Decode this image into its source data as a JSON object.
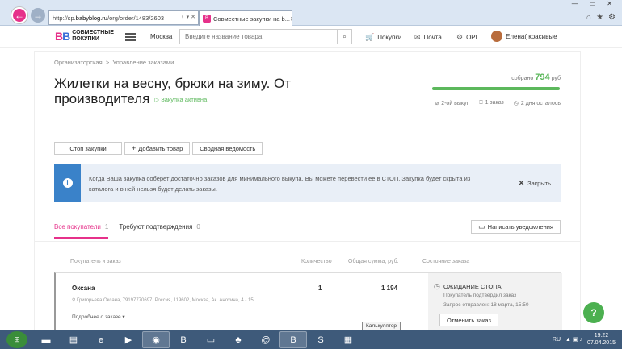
{
  "browser": {
    "url_prefix": "http://sp.",
    "url_host": "babyblog.ru",
    "url_path": "/org/order/1483/2603",
    "address_tools": "♀ ▾ ✕",
    "tab_title": "Совместные закупки на b...",
    "tab_close": "✕",
    "window_controls": [
      "—",
      "▭",
      "✕"
    ],
    "toolbar_icons": [
      "⌂",
      "★",
      "⚙"
    ],
    "back_icon": "←",
    "forward_icon": "→"
  },
  "site": {
    "logo_mark_a": "B",
    "logo_mark_b": "B",
    "logo_line1": "СОВМЕСТНЫЕ",
    "logo_line2": "ПОКУПКИ",
    "city": "Москва",
    "search_placeholder": "Введите название товара",
    "search_icon": "⌕",
    "nav": [
      {
        "icon": "🛒",
        "label": "Покупки"
      },
      {
        "icon": "✉",
        "label": "Почта"
      },
      {
        "icon": "⚙",
        "label": "ОРГ"
      }
    ],
    "user_name": "Елена( красивые"
  },
  "page": {
    "breadcrumbs": [
      "Организаторская",
      "Управление заказами"
    ],
    "crumb_sep": ">",
    "title": "Жилетки на весну, брюки на зиму. От производителя",
    "status": "▷ Закупка активна",
    "collected_prefix": "собрано",
    "collected_value": "794",
    "collected_suffix": "руб",
    "progress": 1.0,
    "meta": [
      {
        "icon": "⌀",
        "text": "2-ой выкуп"
      },
      {
        "icon": "⎕",
        "text": "1 заказ"
      },
      {
        "icon": "◷",
        "text": "2 дня осталось"
      }
    ],
    "buttons": {
      "stop": "Стоп закупки",
      "add_product": "Добавить товар",
      "add_icon": "+",
      "summary": "Сводная ведомость"
    },
    "alert": {
      "icon": "i",
      "text": "Когда Ваша закупка соберет достаточно заказов для минимального выкупа, Вы можете перевести ее в СТОП. Закупка будет скрыта из каталога и в ней нельзя будет делать заказы.",
      "close_icon": "✕",
      "close_label": "Закрыть"
    },
    "tabs": [
      {
        "label": "Все покупатели",
        "count": "1"
      },
      {
        "label": "Требуют подтверждения",
        "count": "0"
      }
    ],
    "notify_icon": "▭",
    "notify_label": "Написать уведомления",
    "table": {
      "headers": [
        "Покупатель и заказ",
        "Количество",
        "Общая сумма, руб.",
        "Состояние заказа"
      ],
      "row": {
        "name": "Оксана",
        "address": "⚲ Григорьева Оксана, 79197770697, Россия, 119602, Москва, Ак. Анохина, 4 - 15",
        "more": "Подробнее о заказе ▾",
        "qty": "1",
        "sum": "1 194",
        "state_icon": "◷",
        "state": "ОЖИДАНИЕ СТОПА",
        "state_sub1": "Покупатель подтвердил заказ",
        "state_sub2": "Запрос отправлен: 18 марта, 15:50",
        "cancel": "Отменить заказ"
      }
    },
    "help_icon": "?"
  },
  "tooltip": "Калькулятор",
  "taskbar": {
    "start_icon": "⊞",
    "apps": [
      "▬",
      "▤",
      "e",
      "▶",
      "◉",
      "B",
      "▭",
      "♣",
      "@",
      "B",
      "S",
      "▦"
    ],
    "lang": "RU",
    "tray_icons": "▲ ▣ ♪",
    "time": "19:22",
    "date": "07.04.2015"
  }
}
